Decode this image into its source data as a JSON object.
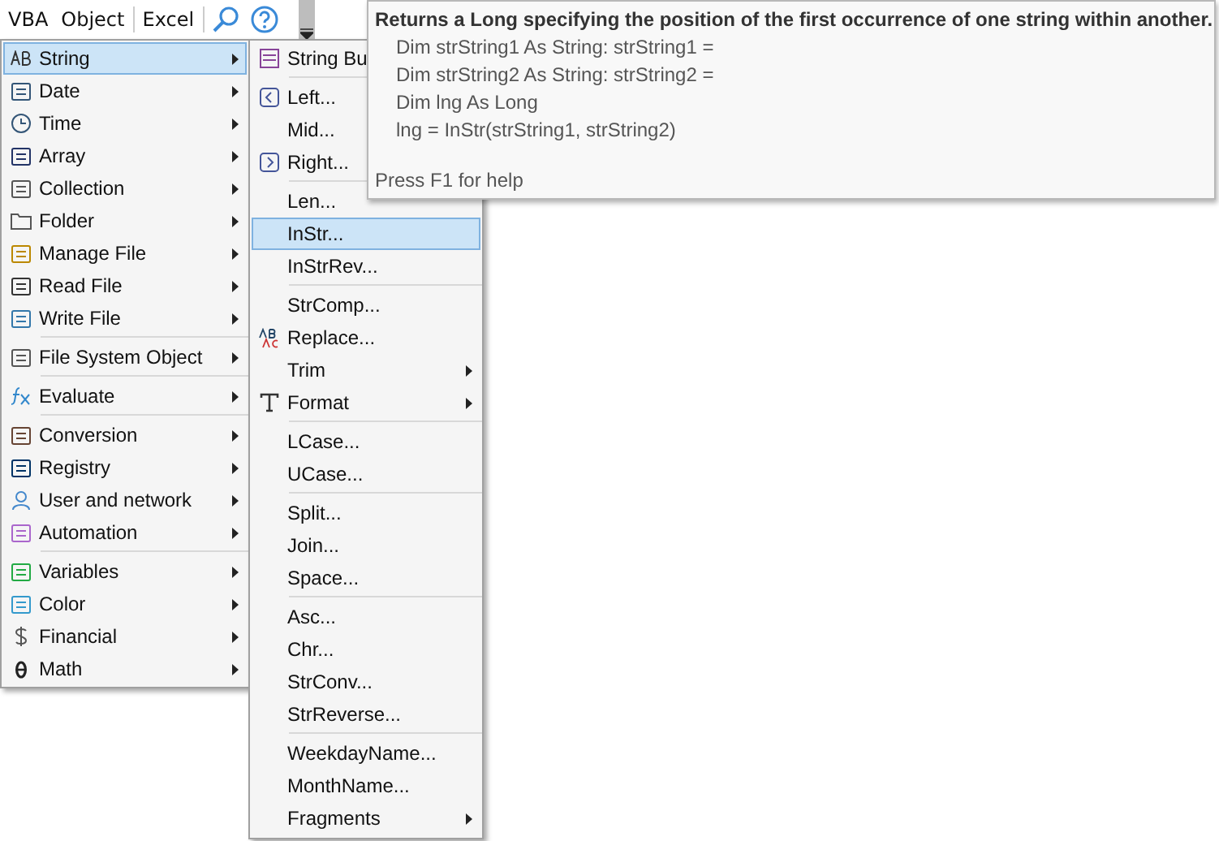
{
  "toolbar": {
    "buttons": [
      "VBA",
      "Object",
      "Excel"
    ]
  },
  "main_menu": {
    "groups": [
      [
        {
          "label": "String",
          "has_submenu": true,
          "selected": true
        },
        {
          "label": "Date",
          "has_submenu": true,
          "selected": false
        },
        {
          "label": "Time",
          "has_submenu": true,
          "selected": false
        },
        {
          "label": "Array",
          "has_submenu": true,
          "selected": false
        },
        {
          "label": "Collection",
          "has_submenu": true,
          "selected": false
        },
        {
          "label": "Folder",
          "has_submenu": true,
          "selected": false
        },
        {
          "label": "Manage File",
          "has_submenu": true,
          "selected": false
        },
        {
          "label": "Read File",
          "has_submenu": true,
          "selected": false
        },
        {
          "label": "Write File",
          "has_submenu": true,
          "selected": false
        }
      ],
      [
        {
          "label": "File System Object",
          "has_submenu": true,
          "selected": false
        }
      ],
      [
        {
          "label": "Evaluate",
          "has_submenu": true,
          "selected": false
        }
      ],
      [
        {
          "label": "Conversion",
          "has_submenu": true,
          "selected": false
        },
        {
          "label": "Registry",
          "has_submenu": true,
          "selected": false
        },
        {
          "label": "User and network",
          "has_submenu": true,
          "selected": false
        },
        {
          "label": "Automation",
          "has_submenu": true,
          "selected": false
        }
      ],
      [
        {
          "label": "Variables",
          "has_submenu": true,
          "selected": false
        },
        {
          "label": "Color",
          "has_submenu": true,
          "selected": false
        },
        {
          "label": "Financial",
          "has_submenu": true,
          "selected": false
        },
        {
          "label": "Math",
          "has_submenu": true,
          "selected": false
        }
      ]
    ]
  },
  "sub_menu": {
    "groups": [
      [
        {
          "label": "String Bu",
          "has_submenu": false,
          "selected": false
        }
      ],
      [
        {
          "label": "Left...",
          "has_submenu": false,
          "selected": false
        },
        {
          "label": "Mid...",
          "has_submenu": false,
          "selected": false
        },
        {
          "label": "Right...",
          "has_submenu": false,
          "selected": false
        }
      ],
      [
        {
          "label": "Len...",
          "has_submenu": false,
          "selected": false
        },
        {
          "label": "InStr...",
          "has_submenu": false,
          "selected": true
        },
        {
          "label": "InStrRev...",
          "has_submenu": false,
          "selected": false
        }
      ],
      [
        {
          "label": "StrComp...",
          "has_submenu": false,
          "selected": false
        },
        {
          "label": "Replace...",
          "has_submenu": false,
          "selected": false
        },
        {
          "label": "Trim",
          "has_submenu": true,
          "selected": false
        },
        {
          "label": "Format",
          "has_submenu": true,
          "selected": false
        }
      ],
      [
        {
          "label": "LCase...",
          "has_submenu": false,
          "selected": false
        },
        {
          "label": "UCase...",
          "has_submenu": false,
          "selected": false
        }
      ],
      [
        {
          "label": "Split...",
          "has_submenu": false,
          "selected": false
        },
        {
          "label": "Join...",
          "has_submenu": false,
          "selected": false
        },
        {
          "label": "Space...",
          "has_submenu": false,
          "selected": false
        }
      ],
      [
        {
          "label": "Asc...",
          "has_submenu": false,
          "selected": false
        },
        {
          "label": "Chr...",
          "has_submenu": false,
          "selected": false
        },
        {
          "label": "StrConv...",
          "has_submenu": false,
          "selected": false
        },
        {
          "label": "StrReverse...",
          "has_submenu": false,
          "selected": false
        }
      ],
      [
        {
          "label": "WeekdayName...",
          "has_submenu": false,
          "selected": false
        },
        {
          "label": "MonthName...",
          "has_submenu": false,
          "selected": false
        },
        {
          "label": "Fragments",
          "has_submenu": true,
          "selected": false
        }
      ]
    ]
  },
  "tooltip": {
    "title": "Returns a  Long specifying the position of the first occurrence of one string within another.",
    "code_lines": [
      "Dim strString1 As String: strString1 =",
      "Dim strString2 As String: strString2 =",
      "Dim lng As Long",
      "lng = InStr(strString1, strString2)"
    ],
    "footer": "Press F1 for help"
  }
}
